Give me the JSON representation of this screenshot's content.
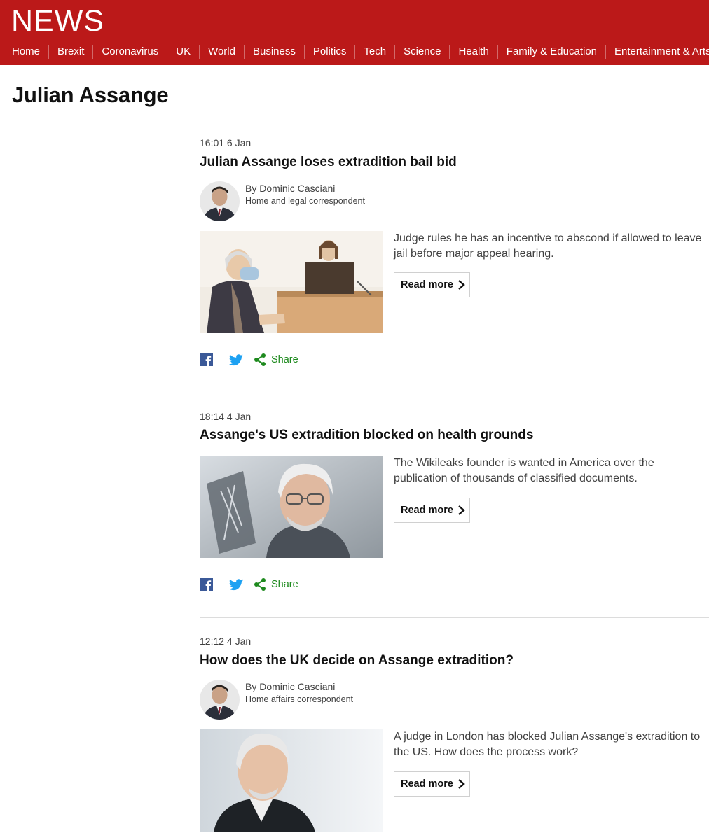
{
  "header": {
    "logo": "NEWS",
    "nav": [
      "Home",
      "Brexit",
      "Coronavirus",
      "UK",
      "World",
      "Business",
      "Politics",
      "Tech",
      "Science",
      "Health",
      "Family & Education",
      "Entertainment & Arts"
    ]
  },
  "page_title": "Julian Assange",
  "colors": {
    "brand_red": "#bb1919",
    "share_green": "#1e8a1e",
    "facebook_blue": "#3b5998",
    "twitter_blue": "#1da1f2"
  },
  "icons": [
    "facebook-icon",
    "twitter-icon",
    "share-icon",
    "chevron-right-icon"
  ],
  "articles": [
    {
      "time": "16:01 6 Jan",
      "headline": "Julian Assange loses extradition bail bid",
      "author_name": "By Dominic Casciani",
      "author_role": "Home and legal correspondent",
      "summary": "Judge rules he has an incentive to abscond if allowed to leave jail before major appeal hearing.",
      "read_more": "Read more",
      "share": "Share"
    },
    {
      "time": "18:14 4 Jan",
      "headline": "Assange's US extradition blocked on health grounds",
      "summary": "The Wikileaks founder is wanted in America over the publication of thousands of classified documents.",
      "read_more": "Read more",
      "share": "Share"
    },
    {
      "time": "12:12 4 Jan",
      "headline": "How does the UK decide on Assange extradition?",
      "author_name": "By Dominic Casciani",
      "author_role": "Home affairs correspondent",
      "summary": "A judge in London has blocked Julian Assange's extradition to the US. How does the process work?",
      "read_more": "Read more"
    }
  ]
}
